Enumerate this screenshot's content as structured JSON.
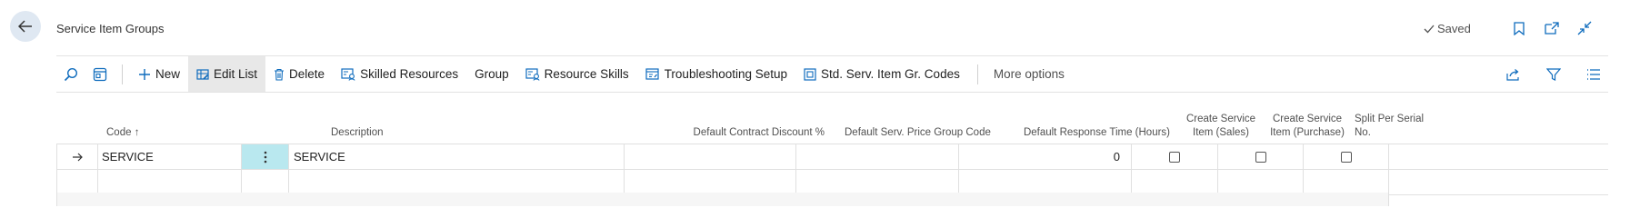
{
  "header": {
    "title": "Service Item Groups",
    "saved_label": "Saved"
  },
  "toolbar": {
    "new_label": "New",
    "edit_list_label": "Edit List",
    "delete_label": "Delete",
    "skilled_resources_label": "Skilled Resources",
    "group_label": "Group",
    "resource_skills_label": "Resource Skills",
    "troubleshooting_setup_label": "Troubleshooting Setup",
    "std_codes_label": "Std. Serv. Item Gr. Codes",
    "more_options_label": "More options"
  },
  "table": {
    "columns": {
      "code": "Code",
      "description": "Description",
      "default_contract_discount": "Default Contract Discount %",
      "default_serv_price_group_code": "Default Serv. Price Group Code",
      "default_response_time": "Default Response Time (Hours)",
      "create_service_item_sales_1": "Create Service",
      "create_service_item_sales_2": "Item (Sales)",
      "create_service_item_purchase_1": "Create Service",
      "create_service_item_purchase_2": "Item (Purchase)",
      "split_per_serial_1": "Split Per Serial",
      "split_per_serial_2": "No."
    },
    "sort_indicator": "↑",
    "rows": [
      {
        "code": "SERVICE",
        "description": "SERVICE",
        "default_contract_discount": "",
        "default_serv_price_group_code": "",
        "default_response_time": "0",
        "create_service_item_sales": false,
        "create_service_item_purchase": false,
        "split_per_serial": false
      }
    ]
  },
  "colors": {
    "accent": "#0f6cbd",
    "selected_cell": "#b9e8ef",
    "back_button_bg": "#dfe8f2"
  },
  "icons": [
    "back-arrow-icon",
    "checkmark-icon",
    "bookmark-icon",
    "open-new-window-icon",
    "collapse-icon",
    "search-icon",
    "page-view-icon",
    "plus-icon",
    "edit-list-icon",
    "trash-icon",
    "skilled-resources-icon",
    "resource-skills-icon",
    "troubleshooting-icon",
    "std-codes-icon",
    "share-icon",
    "filter-icon",
    "list-view-icon",
    "row-arrow-icon",
    "row-menu-icon"
  ]
}
